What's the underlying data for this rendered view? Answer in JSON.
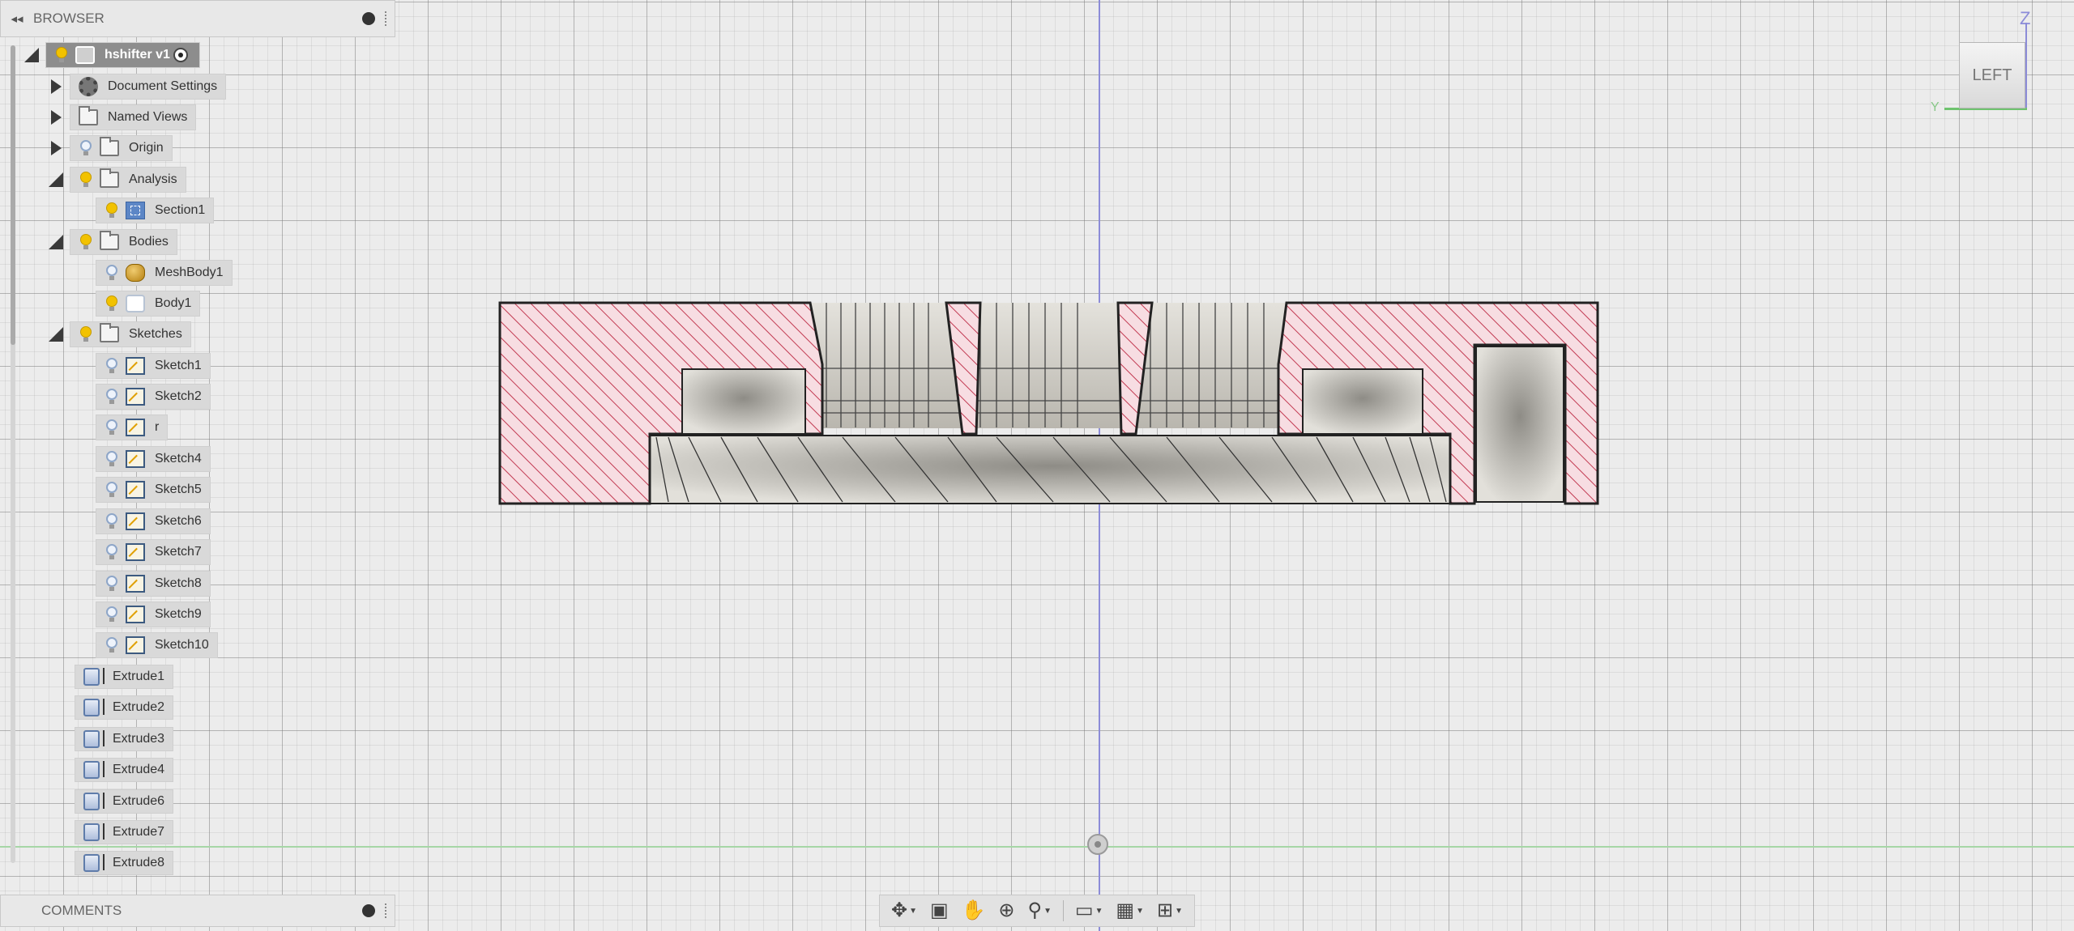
{
  "browser": {
    "title": "BROWSER",
    "collapse_glyph": "◂◂",
    "root": {
      "label": "hshifter v1"
    },
    "items": [
      {
        "label": "Document Settings"
      },
      {
        "label": "Named Views"
      },
      {
        "label": "Origin"
      },
      {
        "label": "Analysis"
      },
      {
        "label": "Section1"
      },
      {
        "label": "Bodies"
      },
      {
        "label": "MeshBody1"
      },
      {
        "label": "Body1"
      },
      {
        "label": "Sketches"
      }
    ],
    "sketches": [
      "Sketch1",
      "Sketch2",
      "r",
      "Sketch4",
      "Sketch5",
      "Sketch6",
      "Sketch7",
      "Sketch8",
      "Sketch9",
      "Sketch10"
    ]
  },
  "timeline": [
    "Extrude1",
    "Extrude2",
    "Extrude3",
    "Extrude4",
    "Extrude6",
    "Extrude7",
    "Extrude8"
  ],
  "comments": {
    "title": "COMMENTS"
  },
  "viewcube": {
    "face": "LEFT",
    "axis_up": "Z",
    "axis_side": "Y"
  },
  "nav_icons": [
    "orbit-icon",
    "look-at-icon",
    "pan-icon",
    "zoom-window-icon",
    "zoom-icon",
    "display-settings-icon",
    "grid-settings-icon",
    "viewports-icon"
  ],
  "colors": {
    "section_hatch_fill": "#f7dde2",
    "hatch_line": "#c23a52",
    "wall_gray": "#d5d3cc",
    "model_edge": "#222222",
    "z_axis": "#8c8cd8",
    "y_axis": "#6fc36f"
  }
}
